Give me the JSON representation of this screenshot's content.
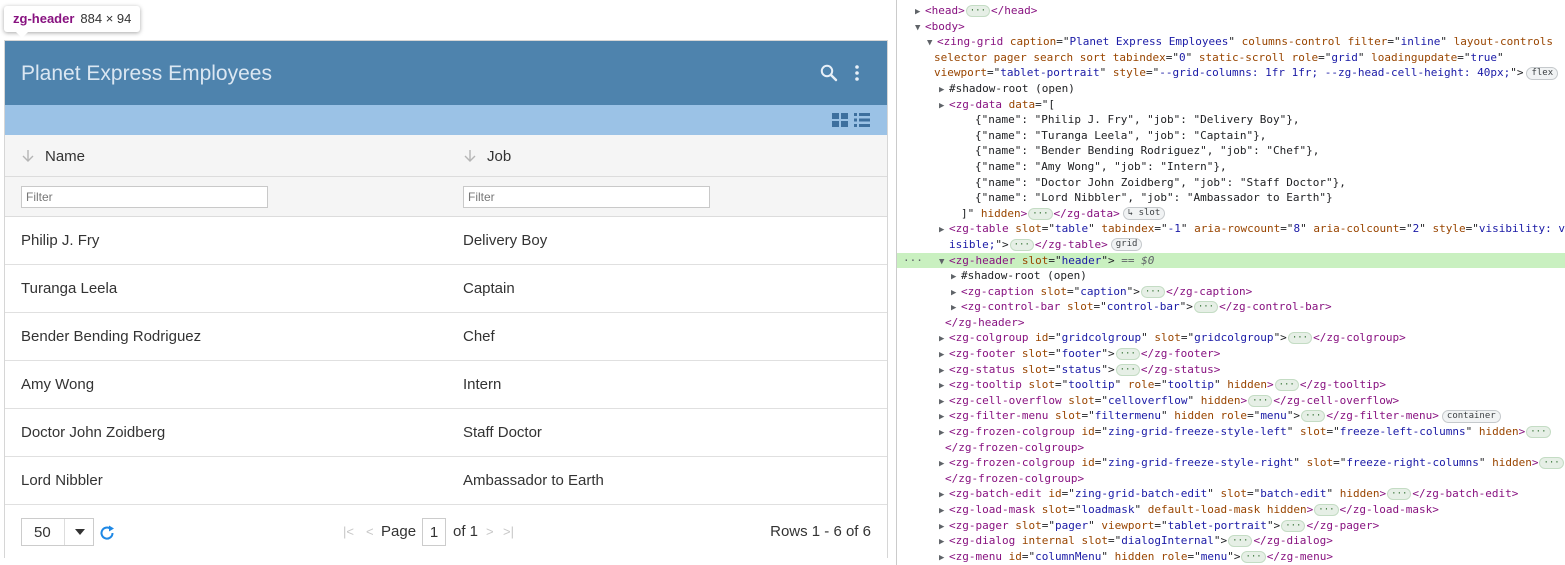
{
  "tooltip": {
    "tag": "zg-header",
    "size": "884 × 94"
  },
  "grid": {
    "caption": "Planet Express Employees",
    "columns": [
      {
        "label": "Name",
        "filter_placeholder": "Filter"
      },
      {
        "label": "Job",
        "filter_placeholder": "Filter"
      }
    ],
    "rows": [
      {
        "name": "Philip J. Fry",
        "job": "Delivery Boy"
      },
      {
        "name": "Turanga Leela",
        "job": "Captain"
      },
      {
        "name": "Bender Bending Rodriguez",
        "job": "Chef"
      },
      {
        "name": "Amy Wong",
        "job": "Intern"
      },
      {
        "name": "Doctor John Zoidberg",
        "job": "Staff Doctor"
      },
      {
        "name": "Lord Nibbler",
        "job": "Ambassador to Earth"
      }
    ],
    "pager": {
      "page_size": "50",
      "page_label": "Page",
      "page_value": "1",
      "of_label": "of 1",
      "rows_label": "Rows 1 - 6 of 6"
    }
  },
  "colors": {
    "caption_bg": "#4e83ad",
    "control_bar_bg": "#9bc2e6",
    "selected_node_bg": "#c9f0c0",
    "tag_color": "#881280",
    "attr_name_color": "#994500",
    "attr_value_color": "#1a1aa6"
  },
  "devtools": {
    "lines": [
      [
        [
          "ar",
          "▶"
        ],
        [
          "tg",
          "<head>"
        ],
        [
          "dots",
          "···"
        ],
        [
          "tg",
          "</head>"
        ]
      ],
      [
        [
          "ar",
          "▼"
        ],
        [
          "tg",
          "<body>"
        ]
      ],
      [
        [
          "ar",
          "▼"
        ],
        [
          "tg",
          "<zing-grid "
        ],
        [
          "an",
          "caption"
        ],
        [
          "tx",
          "=\""
        ],
        [
          "av",
          "Planet Express Employees"
        ],
        [
          "tx",
          "\" "
        ],
        [
          "an",
          "columns-control"
        ],
        [
          "tx",
          " "
        ],
        [
          "an",
          "filter"
        ],
        [
          "tx",
          "=\""
        ],
        [
          "av",
          "inline"
        ],
        [
          "tx",
          "\" "
        ],
        [
          "an",
          "layout-controls"
        ]
      ],
      [
        [
          "an",
          "selector pager search sort tabindex"
        ],
        [
          "tx",
          "=\""
        ],
        [
          "av",
          "0"
        ],
        [
          "tx",
          "\" "
        ],
        [
          "an",
          "static-scroll role"
        ],
        [
          "tx",
          "=\""
        ],
        [
          "av",
          "grid"
        ],
        [
          "tx",
          "\" "
        ],
        [
          "an",
          "loadingupdate"
        ],
        [
          "tx",
          "=\""
        ],
        [
          "av",
          "true"
        ],
        [
          "tx",
          "\""
        ]
      ],
      [
        [
          "an",
          "viewport"
        ],
        [
          "tx",
          "=\""
        ],
        [
          "av",
          "tablet-portrait"
        ],
        [
          "tx",
          "\" "
        ],
        [
          "an",
          "style"
        ],
        [
          "tx",
          "=\""
        ],
        [
          "av",
          "--grid-columns: 1fr 1fr; --zg-head-cell-height: 40px;"
        ],
        [
          "tx",
          "\">"
        ],
        [
          "badge",
          "flex"
        ]
      ],
      [
        [
          "ar",
          "▶"
        ],
        [
          "tx",
          "#shadow-root (open)"
        ]
      ],
      [
        [
          "ar",
          "▶"
        ],
        [
          "tg",
          "<zg-data "
        ],
        [
          "an",
          "data"
        ],
        [
          "tx",
          "=\"["
        ]
      ],
      [
        [
          "tx",
          "{\"name\": \"Philip J. Fry\", \"job\": \"Delivery Boy\"},"
        ]
      ],
      [
        [
          "tx",
          "{\"name\": \"Turanga Leela\", \"job\": \"Captain\"},"
        ]
      ],
      [
        [
          "tx",
          "{\"name\": \"Bender Bending Rodriguez\", \"job\": \"Chef\"},"
        ]
      ],
      [
        [
          "tx",
          "{\"name\": \"Amy Wong\", \"job\": \"Intern\"},"
        ]
      ],
      [
        [
          "tx",
          "{\"name\": \"Doctor John Zoidberg\", \"job\": \"Staff Doctor\"},"
        ]
      ],
      [
        [
          "tx",
          "{\"name\": \"Lord Nibbler\", \"job\": \"Ambassador to Earth\"}"
        ]
      ],
      [
        [
          "tx",
          "]\" "
        ],
        [
          "an",
          "hidden"
        ],
        [
          "tg",
          ">"
        ],
        [
          "dots",
          "···"
        ],
        [
          "tg",
          "</zg-data>"
        ],
        [
          "badge",
          "↳ slot"
        ]
      ],
      [
        [
          "ar",
          "▶"
        ],
        [
          "tg",
          "<zg-table "
        ],
        [
          "an",
          "slot"
        ],
        [
          "tx",
          "=\""
        ],
        [
          "av",
          "table"
        ],
        [
          "tx",
          "\" "
        ],
        [
          "an",
          "tabindex"
        ],
        [
          "tx",
          "=\""
        ],
        [
          "av",
          "-1"
        ],
        [
          "tx",
          "\" "
        ],
        [
          "an",
          "aria-rowcount"
        ],
        [
          "tx",
          "=\""
        ],
        [
          "av",
          "8"
        ],
        [
          "tx",
          "\" "
        ],
        [
          "an",
          "aria-colcount"
        ],
        [
          "tx",
          "=\""
        ],
        [
          "av",
          "2"
        ],
        [
          "tx",
          "\" "
        ],
        [
          "an",
          "style"
        ],
        [
          "tx",
          "=\""
        ],
        [
          "av",
          "visibility: v"
        ]
      ],
      [
        [
          "av",
          "isible;"
        ],
        [
          "tx",
          "\">"
        ],
        [
          "dots",
          "···"
        ],
        [
          "tg",
          "</zg-table>"
        ],
        [
          "badge",
          "grid"
        ]
      ],
      [
        [
          "ar",
          "▼"
        ],
        [
          "tg",
          "<zg-header "
        ],
        [
          "an",
          "slot"
        ],
        [
          "tx",
          "=\""
        ],
        [
          "av",
          "header"
        ],
        [
          "tx",
          "\">"
        ],
        [
          "eq",
          " == $0"
        ]
      ],
      [
        [
          "ar",
          "▶"
        ],
        [
          "tx",
          "#shadow-root (open)"
        ]
      ],
      [
        [
          "ar",
          "▶"
        ],
        [
          "tg",
          "<zg-caption "
        ],
        [
          "an",
          "slot"
        ],
        [
          "tx",
          "=\""
        ],
        [
          "av",
          "caption"
        ],
        [
          "tx",
          "\">"
        ],
        [
          "dots",
          "···"
        ],
        [
          "tg",
          "</zg-caption>"
        ]
      ],
      [
        [
          "ar",
          "▶"
        ],
        [
          "tg",
          "<zg-control-bar "
        ],
        [
          "an",
          "slot"
        ],
        [
          "tx",
          "=\""
        ],
        [
          "av",
          "control-bar"
        ],
        [
          "tx",
          "\">"
        ],
        [
          "dots",
          "···"
        ],
        [
          "tg",
          "</zg-control-bar>"
        ]
      ],
      [
        [
          "tg",
          "</zg-header>"
        ]
      ],
      [
        [
          "ar",
          "▶"
        ],
        [
          "tg",
          "<zg-colgroup "
        ],
        [
          "an",
          "id"
        ],
        [
          "tx",
          "=\""
        ],
        [
          "av",
          "gridcolgroup"
        ],
        [
          "tx",
          "\" "
        ],
        [
          "an",
          "slot"
        ],
        [
          "tx",
          "=\""
        ],
        [
          "av",
          "gridcolgroup"
        ],
        [
          "tx",
          "\">"
        ],
        [
          "dots",
          "···"
        ],
        [
          "tg",
          "</zg-colgroup>"
        ]
      ],
      [
        [
          "ar",
          "▶"
        ],
        [
          "tg",
          "<zg-footer "
        ],
        [
          "an",
          "slot"
        ],
        [
          "tx",
          "=\""
        ],
        [
          "av",
          "footer"
        ],
        [
          "tx",
          "\">"
        ],
        [
          "dots",
          "···"
        ],
        [
          "tg",
          "</zg-footer>"
        ]
      ],
      [
        [
          "ar",
          "▶"
        ],
        [
          "tg",
          "<zg-status "
        ],
        [
          "an",
          "slot"
        ],
        [
          "tx",
          "=\""
        ],
        [
          "av",
          "status"
        ],
        [
          "tx",
          "\">"
        ],
        [
          "dots",
          "···"
        ],
        [
          "tg",
          "</zg-status>"
        ]
      ],
      [
        [
          "ar",
          "▶"
        ],
        [
          "tg",
          "<zg-tooltip "
        ],
        [
          "an",
          "slot"
        ],
        [
          "tx",
          "=\""
        ],
        [
          "av",
          "tooltip"
        ],
        [
          "tx",
          "\" "
        ],
        [
          "an",
          "role"
        ],
        [
          "tx",
          "=\""
        ],
        [
          "av",
          "tooltip"
        ],
        [
          "tx",
          "\" "
        ],
        [
          "an",
          "hidden"
        ],
        [
          "tg",
          ">"
        ],
        [
          "dots",
          "···"
        ],
        [
          "tg",
          "</zg-tooltip>"
        ]
      ],
      [
        [
          "ar",
          "▶"
        ],
        [
          "tg",
          "<zg-cell-overflow "
        ],
        [
          "an",
          "slot"
        ],
        [
          "tx",
          "=\""
        ],
        [
          "av",
          "celloverflow"
        ],
        [
          "tx",
          "\" "
        ],
        [
          "an",
          "hidden"
        ],
        [
          "tg",
          ">"
        ],
        [
          "dots",
          "···"
        ],
        [
          "tg",
          "</zg-cell-overflow>"
        ]
      ],
      [
        [
          "ar",
          "▶"
        ],
        [
          "tg",
          "<zg-filter-menu "
        ],
        [
          "an",
          "slot"
        ],
        [
          "tx",
          "=\""
        ],
        [
          "av",
          "filtermenu"
        ],
        [
          "tx",
          "\" "
        ],
        [
          "an",
          "hidden role"
        ],
        [
          "tx",
          "=\""
        ],
        [
          "av",
          "menu"
        ],
        [
          "tx",
          "\">"
        ],
        [
          "dots",
          "···"
        ],
        [
          "tg",
          "</zg-filter-menu>"
        ],
        [
          "badge",
          "container"
        ]
      ],
      [
        [
          "ar",
          "▶"
        ],
        [
          "tg",
          "<zg-frozen-colgroup "
        ],
        [
          "an",
          "id"
        ],
        [
          "tx",
          "=\""
        ],
        [
          "av",
          "zing-grid-freeze-style-left"
        ],
        [
          "tx",
          "\" "
        ],
        [
          "an",
          "slot"
        ],
        [
          "tx",
          "=\""
        ],
        [
          "av",
          "freeze-left-columns"
        ],
        [
          "tx",
          "\" "
        ],
        [
          "an",
          "hidden"
        ],
        [
          "tg",
          ">"
        ],
        [
          "dots",
          "···"
        ]
      ],
      [
        [
          "tg",
          "</zg-frozen-colgroup>"
        ]
      ],
      [
        [
          "ar",
          "▶"
        ],
        [
          "tg",
          "<zg-frozen-colgroup "
        ],
        [
          "an",
          "id"
        ],
        [
          "tx",
          "=\""
        ],
        [
          "av",
          "zing-grid-freeze-style-right"
        ],
        [
          "tx",
          "\" "
        ],
        [
          "an",
          "slot"
        ],
        [
          "tx",
          "=\""
        ],
        [
          "av",
          "freeze-right-columns"
        ],
        [
          "tx",
          "\" "
        ],
        [
          "an",
          "hidden"
        ],
        [
          "tg",
          ">"
        ],
        [
          "dots",
          "···"
        ]
      ],
      [
        [
          "tg",
          "</zg-frozen-colgroup>"
        ]
      ],
      [
        [
          "ar",
          "▶"
        ],
        [
          "tg",
          "<zg-batch-edit "
        ],
        [
          "an",
          "id"
        ],
        [
          "tx",
          "=\""
        ],
        [
          "av",
          "zing-grid-batch-edit"
        ],
        [
          "tx",
          "\" "
        ],
        [
          "an",
          "slot"
        ],
        [
          "tx",
          "=\""
        ],
        [
          "av",
          "batch-edit"
        ],
        [
          "tx",
          "\" "
        ],
        [
          "an",
          "hidden"
        ],
        [
          "tg",
          ">"
        ],
        [
          "dots",
          "···"
        ],
        [
          "tg",
          "</zg-batch-edit>"
        ]
      ],
      [
        [
          "ar",
          "▶"
        ],
        [
          "tg",
          "<zg-load-mask "
        ],
        [
          "an",
          "slot"
        ],
        [
          "tx",
          "=\""
        ],
        [
          "av",
          "loadmask"
        ],
        [
          "tx",
          "\" "
        ],
        [
          "an",
          "default-load-mask hidden"
        ],
        [
          "tg",
          ">"
        ],
        [
          "dots",
          "···"
        ],
        [
          "tg",
          "</zg-load-mask>"
        ]
      ],
      [
        [
          "ar",
          "▶"
        ],
        [
          "tg",
          "<zg-pager "
        ],
        [
          "an",
          "slot"
        ],
        [
          "tx",
          "=\""
        ],
        [
          "av",
          "pager"
        ],
        [
          "tx",
          "\" "
        ],
        [
          "an",
          "viewport"
        ],
        [
          "tx",
          "=\""
        ],
        [
          "av",
          "tablet-portrait"
        ],
        [
          "tx",
          "\">"
        ],
        [
          "dots",
          "···"
        ],
        [
          "tg",
          "</zg-pager>"
        ]
      ],
      [
        [
          "ar",
          "▶"
        ],
        [
          "tg",
          "<zg-dialog "
        ],
        [
          "an",
          "internal slot"
        ],
        [
          "tx",
          "=\""
        ],
        [
          "av",
          "dialogInternal"
        ],
        [
          "tx",
          "\">"
        ],
        [
          "dots",
          "···"
        ],
        [
          "tg",
          "</zg-dialog>"
        ]
      ],
      [
        [
          "ar",
          "▶"
        ],
        [
          "tg",
          "<zg-menu "
        ],
        [
          "an",
          "id"
        ],
        [
          "tx",
          "=\""
        ],
        [
          "av",
          "columnMenu"
        ],
        [
          "tx",
          "\" "
        ],
        [
          "an",
          "hidden role"
        ],
        [
          "tx",
          "=\""
        ],
        [
          "av",
          "menu"
        ],
        [
          "tx",
          "\">"
        ],
        [
          "dots",
          "···"
        ],
        [
          "tg",
          "</zg-menu>"
        ]
      ]
    ]
  }
}
